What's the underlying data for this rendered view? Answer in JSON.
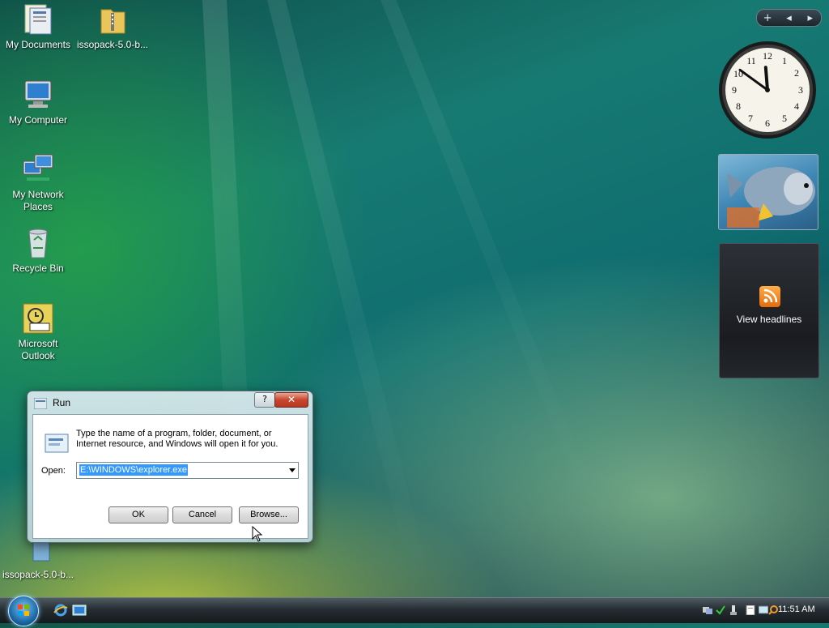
{
  "desktop": {
    "icons": [
      {
        "label": "My Documents",
        "icon": "documents-folder-icon"
      },
      {
        "label": "issopack-5.0-b...",
        "icon": "zip-folder-icon"
      },
      {
        "label": "My Computer",
        "icon": "computer-icon"
      },
      {
        "label": "My Network Places",
        "icon": "network-icon"
      },
      {
        "label": "Recycle Bin",
        "icon": "recycle-bin-icon"
      },
      {
        "label": "Microsoft Outlook",
        "icon": "outlook-icon"
      },
      {
        "label": "issopack-5.0-b...",
        "icon": "installer-icon"
      }
    ]
  },
  "sidebar": {
    "controls": [
      "+",
      "◂",
      "▸"
    ],
    "clock": {
      "hour": 11,
      "minute": 51
    },
    "feed_label": "View headlines"
  },
  "run_dialog": {
    "title": "Run",
    "help_label": "?",
    "close_label": "✕",
    "description": "Type the name of a program, folder, document, or Internet resource, and Windows will open it for you.",
    "open_label": "Open:",
    "open_value": "E:\\WINDOWS\\explorer.exe",
    "ok_label": "OK",
    "cancel_label": "Cancel",
    "browse_label": "Browse..."
  },
  "taskbar": {
    "time": "11:51 AM",
    "colors": {
      "taskbar": "#262e33",
      "selection": "#3399ff"
    }
  }
}
